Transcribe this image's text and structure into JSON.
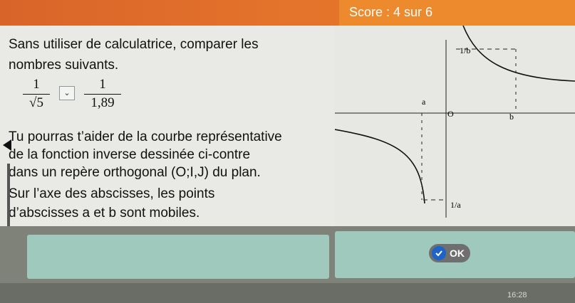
{
  "header": {
    "score": "Score : 4 sur 6"
  },
  "exercise": {
    "line1": "Sans utiliser de calculatrice, comparer les",
    "line2": "nombres suivants.",
    "fraction1": {
      "num": "1",
      "den": "√5"
    },
    "fraction2": {
      "num": "1",
      "den": "1,89"
    },
    "compare_select": "⌄",
    "hint1": "Tu pourras t’aider de la courbe représentative",
    "hint2": "de la fonction inverse dessinée ci-contre",
    "hint3": "dans un repère orthogonal (O;I,J) du plan.",
    "hint4": "Sur l’axe des abscisses, les points",
    "hint5": "d’abscisses a et b sont mobiles."
  },
  "graph": {
    "one_over_b": "1/b",
    "b_label": "b",
    "a_label": "a",
    "o_label": "O",
    "one_over_a": "1/a"
  },
  "actions": {
    "ok_label": "OK"
  },
  "system": {
    "time": "16:28"
  }
}
